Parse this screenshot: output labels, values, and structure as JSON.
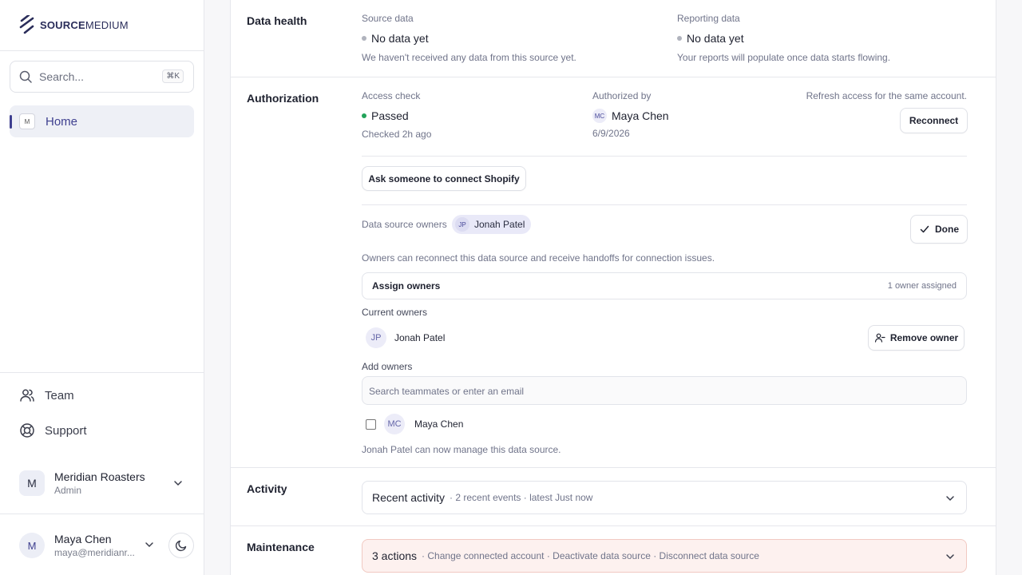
{
  "brand": {
    "name_bold": "SOURCE",
    "name_rest": "MEDIUM"
  },
  "search": {
    "placeholder": "Search...",
    "shortcut": "⌘K"
  },
  "nav": {
    "home": {
      "label": "Home",
      "icon_text": "M"
    }
  },
  "sidebar_links": [
    {
      "label": "Team",
      "icon": "users-icon"
    },
    {
      "label": "Support",
      "icon": "lifebuoy-icon"
    }
  ],
  "org": {
    "initial": "M",
    "name": "Meridian Roasters",
    "role": "Admin"
  },
  "user": {
    "initial": "M",
    "name": "Maya Chen",
    "email": "maya@meridianr..."
  },
  "data_health": {
    "title": "Data health",
    "source": {
      "label": "Source data",
      "value": "No data yet",
      "note": "We haven't received any data from this source yet."
    },
    "reporting": {
      "label": "Reporting data",
      "value": "No data yet",
      "note": "Your reports will populate once data starts flowing."
    }
  },
  "authorization": {
    "title": "Authorization",
    "access": {
      "label": "Access check",
      "value": "Passed",
      "note": "Checked 2h ago"
    },
    "authorized_by": {
      "label": "Authorized by",
      "initials": "MC",
      "name": "Maya Chen",
      "date": "6/9/2026"
    },
    "refresh": {
      "note": "Refresh access for the same account.",
      "button": "Reconnect"
    },
    "ask_button": "Ask someone to connect Shopify",
    "owners": {
      "label": "Data source owners",
      "chip": {
        "initials": "JP",
        "name": "Jonah Patel"
      },
      "done_button": "Done",
      "description": "Owners can reconnect this data source and receive handoffs for connection issues.",
      "assign_label": "Assign owners",
      "assign_count": "1 owner assigned",
      "current_label": "Current owners",
      "current": [
        {
          "initials": "JP",
          "name": "Jonah Patel",
          "remove": "Remove owner"
        }
      ],
      "add_label": "Add owners",
      "add_placeholder": "Search teammates or enter an email",
      "candidates": [
        {
          "initials": "MC",
          "name": "Maya Chen"
        }
      ],
      "status": "Jonah Patel can now manage this data source."
    }
  },
  "activity": {
    "title": "Activity",
    "summary": "Recent activity",
    "meta": "· 2 recent events · latest Just now"
  },
  "maintenance": {
    "title": "Maintenance",
    "summary": "3 actions",
    "meta": "· Change connected account · Deactivate data source · Disconnect data source"
  },
  "colors": {
    "accent": "#3e3f8f",
    "passed": "#22a35a",
    "pending": "#b0b3bd",
    "maintenance_bg": "#fdf1ef",
    "maintenance_border": "#f1c9c2"
  }
}
